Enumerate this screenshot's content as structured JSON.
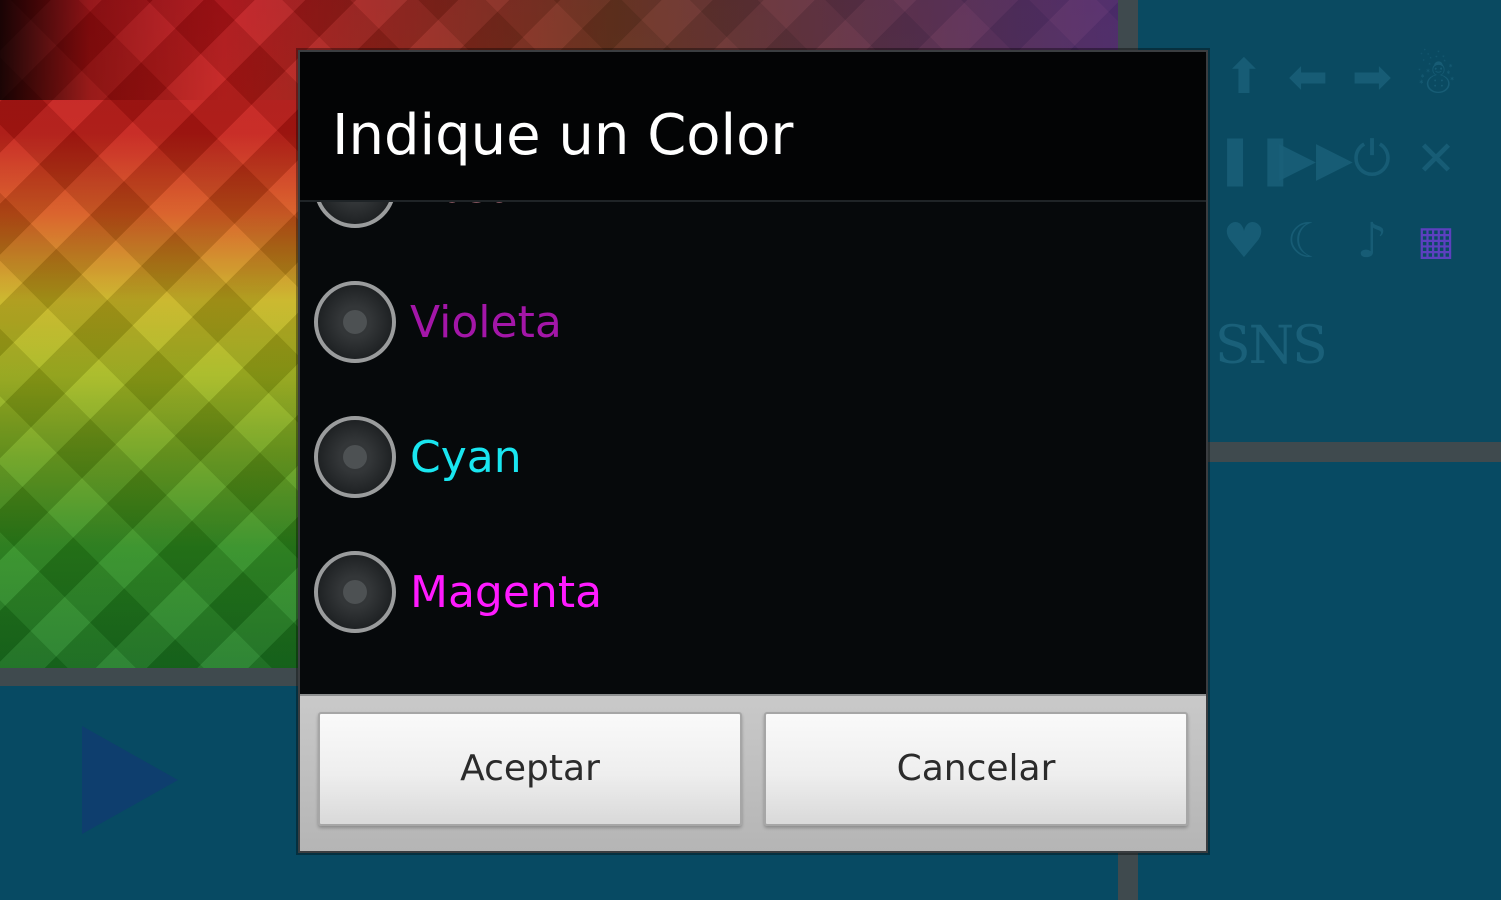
{
  "dialog": {
    "title": "Indique un Color",
    "options": [
      {
        "label": "Rosa",
        "color": "#ff9fb0",
        "selected": false
      },
      {
        "label": "Violeta",
        "color": "#a316a8",
        "selected": false
      },
      {
        "label": "Cyan",
        "color": "#19e6f0",
        "selected": false
      },
      {
        "label": "Magenta",
        "color": "#ff1aff",
        "selected": false
      }
    ],
    "buttons": {
      "accept": "Aceptar",
      "cancel": "Cancelar"
    }
  },
  "background": {
    "icons": [
      "arrow-up-icon",
      "arrow-left-icon",
      "arrow-right-icon",
      "snowman-icon",
      "pause-icon",
      "fast-forward-icon",
      "power-icon",
      "cancel-icon",
      "heart-icon",
      "moon-icon",
      "music-note-icon",
      "color-grid-icon"
    ],
    "icon_glyphs": [
      "⬆",
      "⬅",
      "➡",
      "☃",
      "❚❚",
      "▶▶",
      "⏻",
      "✕",
      "♥",
      "☾",
      "♪",
      "▦"
    ],
    "sns_text": "SNS",
    "play_icon": "play-icon"
  }
}
